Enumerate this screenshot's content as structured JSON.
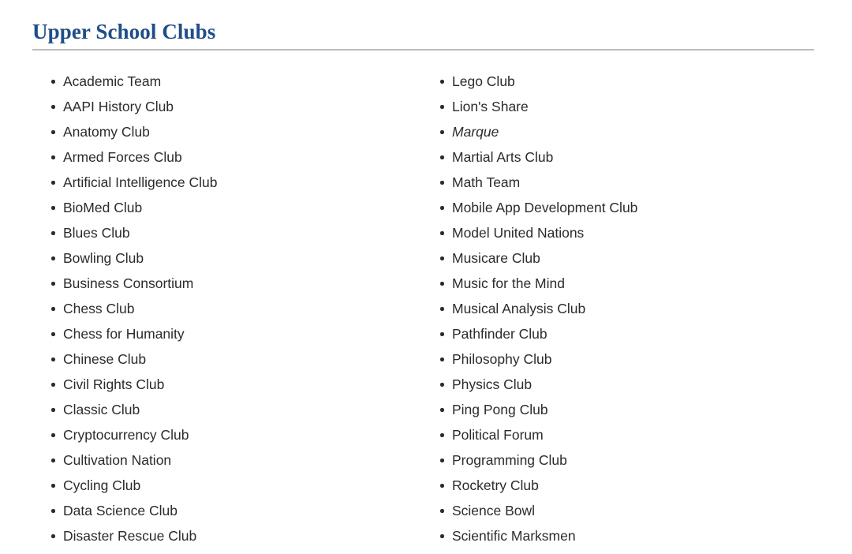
{
  "heading": {
    "title": "Upper School Clubs",
    "color": "#1f4e87",
    "rule_color": "#bdbdbd"
  },
  "text_color": "#2b2b2b",
  "background_color": "#ffffff",
  "clubs": {
    "bullet": "•",
    "left_column": [
      {
        "name": "Academic Team",
        "style": "normal"
      },
      {
        "name": "AAPI History Club",
        "style": "normal"
      },
      {
        "name": "Anatomy Club",
        "style": "normal"
      },
      {
        "name": "Armed Forces Club",
        "style": "normal"
      },
      {
        "name": "Artificial Intelligence Club",
        "style": "normal"
      },
      {
        "name": "BioMed Club",
        "style": "normal"
      },
      {
        "name": "Blues Club",
        "style": "normal"
      },
      {
        "name": "Bowling Club",
        "style": "normal"
      },
      {
        "name": "Business Consortium",
        "style": "normal"
      },
      {
        "name": "Chess Club",
        "style": "normal"
      },
      {
        "name": "Chess for Humanity",
        "style": "normal"
      },
      {
        "name": "Chinese Club",
        "style": "normal"
      },
      {
        "name": "Civil Rights Club",
        "style": "normal"
      },
      {
        "name": "Classic Club",
        "style": "normal"
      },
      {
        "name": "Cryptocurrency Club",
        "style": "normal"
      },
      {
        "name": "Cultivation Nation",
        "style": "normal"
      },
      {
        "name": "Cycling Club",
        "style": "normal"
      },
      {
        "name": "Data Science Club",
        "style": "normal"
      },
      {
        "name": "Disaster Rescue Club",
        "style": "normal"
      }
    ],
    "right_column": [
      {
        "name": "Lego Club",
        "style": "normal"
      },
      {
        "name": "Lion's Share",
        "style": "normal"
      },
      {
        "name": "Marque",
        "style": "italic"
      },
      {
        "name": "Martial Arts Club",
        "style": "normal"
      },
      {
        "name": "Math Team",
        "style": "normal"
      },
      {
        "name": "Mobile App Development Club",
        "style": "normal"
      },
      {
        "name": "Model United Nations",
        "style": "normal"
      },
      {
        "name": "Musicare Club",
        "style": "normal"
      },
      {
        "name": "Music for the Mind",
        "style": "normal"
      },
      {
        "name": "Musical Analysis Club",
        "style": "normal"
      },
      {
        "name": "Pathfinder Club",
        "style": "normal"
      },
      {
        "name": "Philosophy Club",
        "style": "normal"
      },
      {
        "name": "Physics Club",
        "style": "normal"
      },
      {
        "name": "Ping Pong Club",
        "style": "normal"
      },
      {
        "name": "Political Forum",
        "style": "normal"
      },
      {
        "name": "Programming Club",
        "style": "normal"
      },
      {
        "name": "Rocketry Club",
        "style": "normal"
      },
      {
        "name": "Science Bowl",
        "style": "normal"
      },
      {
        "name": "Scientific Marksmen",
        "style": "normal"
      }
    ]
  }
}
